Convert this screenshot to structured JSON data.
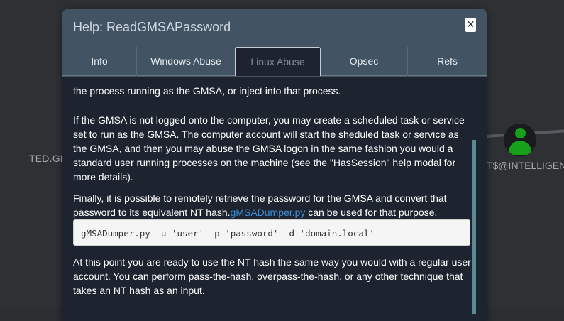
{
  "graph": {
    "left_node_label": "TED.GR",
    "right_node_label": "T$@INTELLIGENC"
  },
  "modal": {
    "title": "Help: ReadGMSAPassword",
    "close_glyph": "✕",
    "tabs": [
      {
        "label": "Info"
      },
      {
        "label": "Windows Abuse"
      },
      {
        "label": "Linux Abuse"
      },
      {
        "label": "Opsec"
      },
      {
        "label": "Refs"
      }
    ],
    "active_tab": "Linux Abuse",
    "content": {
      "para_top": "the process running as the GMSA, or inject into that process.",
      "para_1": "If the GMSA is not logged onto the computer, you may create a scheduled task or service set to run as the GMSA. The computer account will start the sheduled task or service as the GMSA, and then you may abuse the GMSA logon in the same fashion you would a standard user running processes on the machine (see the \"HasSession\" help modal for more details).",
      "para_2_before": "Finally, it is possible to remotely retrieve the password for the GMSA and convert that password to its equivalent NT hash.",
      "para_2_link": "gMSADumper.py",
      "para_2_after": " can be used for that purpose.",
      "code": "gMSADumper.py -u 'user' -p 'password' -d 'domain.local'",
      "para_3": "At this point you are ready to use the NT hash the same way you would with a regular user account. You can perform pass-the-hash, overpass-the-hash, or any other technique that takes an NT hash as an input."
    }
  },
  "colors": {
    "header_bg": "#425363",
    "body_bg": "#1d2430",
    "link": "#3b8fd9",
    "node_green": "#17a11a"
  },
  "icons": {
    "close": "close-icon",
    "user_node": "user-icon"
  }
}
